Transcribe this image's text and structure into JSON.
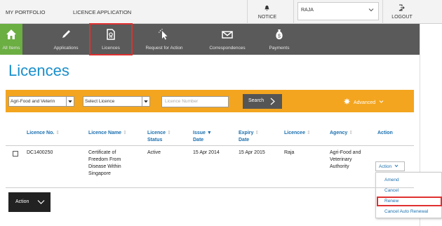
{
  "topbar": {
    "links": [
      "MY PORTFOLIO",
      "LICENCE APPLICATION"
    ],
    "notice": "NOTICE",
    "user": "RAJA",
    "logout": "LOGOUT"
  },
  "nav": [
    {
      "label": "All Items",
      "icon": "home-icon"
    },
    {
      "label": "Applications",
      "icon": "pencil-icon"
    },
    {
      "label": "Licences",
      "icon": "licence-document-icon"
    },
    {
      "label": "Request for Action",
      "icon": "cursor-click-icon"
    },
    {
      "label": "Correspondences",
      "icon": "envelope-icon"
    },
    {
      "label": "Payments",
      "icon": "money-bag-icon"
    }
  ],
  "page": {
    "title": "Licences"
  },
  "search": {
    "agency_value": "Agri-Food and Veterin",
    "licence_value": "Select Licence",
    "number_placeholder": "Licence Number",
    "button": "Search",
    "advanced": "Advanced"
  },
  "table": {
    "headers": {
      "licence_no": "Licence No.",
      "licence_name": "Licence Name",
      "status_1": "Licence",
      "status_2": "Status",
      "issue_1": "Issue",
      "issue_2": "Date",
      "expiry_1": "Expiry",
      "expiry_2": "Date",
      "licencee": "Licencee",
      "agency": "Agency",
      "action": "Action"
    },
    "row": {
      "licence_no": "DC1400250",
      "name_1": "Certificate of",
      "name_2": "Freedom From",
      "name_3": "Disease Within",
      "name_4": "Singapore",
      "status": "Active",
      "issue": "15 Apr 2014",
      "expiry": "15 Apr 2015",
      "licencee": "Raja",
      "agency_1": "Agri-Food and",
      "agency_2": "Veterinary",
      "agency_3": "Authority",
      "action": "Action"
    }
  },
  "menu": [
    "Amend",
    "Cancel",
    "Renew",
    "Cancel Auto Renewal"
  ],
  "footer": {
    "action_button": "Action"
  },
  "colors": {
    "brand_blue": "#1a8fcb",
    "nav_bg": "#5a5a5a",
    "active_green": "#6bae42",
    "search_orange": "#f3a51f",
    "highlight_red": "#e03030"
  }
}
